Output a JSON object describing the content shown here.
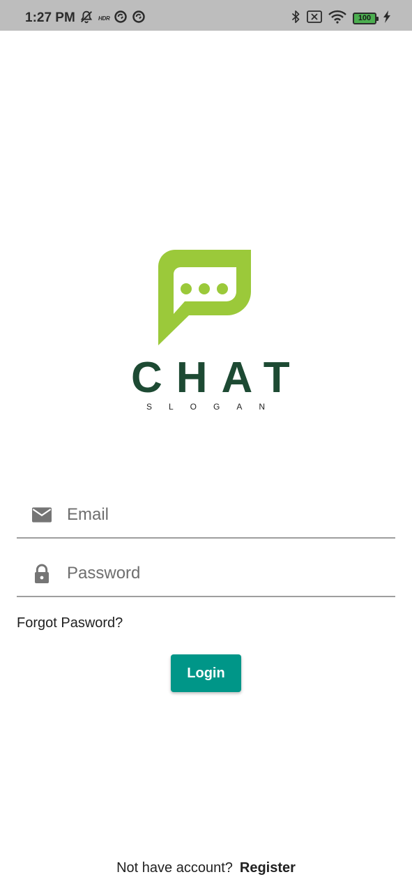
{
  "status_bar": {
    "time": "1:27 PM",
    "left_icons": [
      "muted-notification-icon",
      "hdr-icon",
      "sync-icon",
      "sync-icon"
    ],
    "hdr_label": "HDR",
    "right_icons": [
      "bluetooth-icon",
      "sim-off-icon",
      "wifi-icon",
      "battery-icon",
      "charging-icon"
    ],
    "battery_level": "100"
  },
  "logo": {
    "title": "CHAT",
    "slogan": "SLOGAN"
  },
  "form": {
    "email_placeholder": "Email",
    "email_value": "",
    "password_placeholder": "Password",
    "password_value": "",
    "forgot_label": "Forgot Pasword?",
    "login_label": "Login"
  },
  "footer": {
    "register_prompt": "Not have account?",
    "register_label": "Register"
  },
  "colors": {
    "status_bar": "#bdbdbd",
    "logo_green": "#9bc93a",
    "logo_text": "#1d4a33",
    "accent": "#009688",
    "field_underline": "#9e9e9e",
    "icon_gray": "#757575"
  }
}
